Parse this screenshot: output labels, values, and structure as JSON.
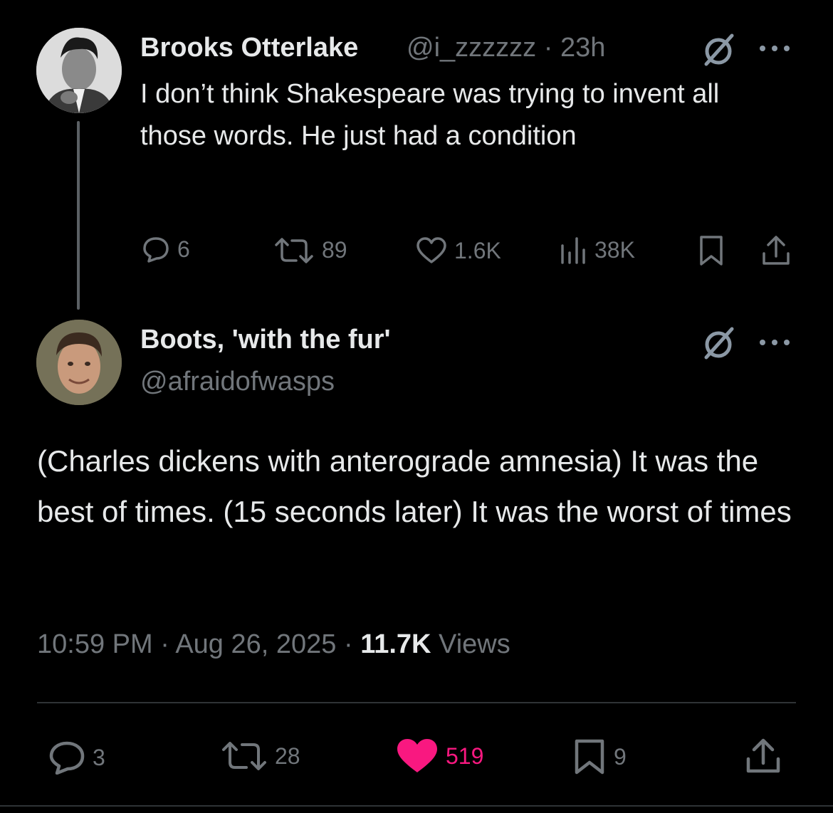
{
  "parent_tweet": {
    "display_name": "Brooks Otterlake",
    "handle": "@i_zzzzzz",
    "separator": "·",
    "time": "23h",
    "text": "I don’t think Shakespeare was trying to invent all those words. He just had a condition",
    "stats": {
      "replies": "6",
      "reposts": "89",
      "likes": "1.6K",
      "views": "38K"
    }
  },
  "main_tweet": {
    "display_name": "Boots, 'with the fur'",
    "handle": "@afraidofwasps",
    "text": "(Charles dickens with anterograde amnesia) It was the best of times. (15 seconds later) It was the worst of times",
    "timestamp": "10:59 PM · Aug 26, 2025 · ",
    "views_count": "11.7K",
    "views_label": " Views",
    "stats": {
      "replies": "3",
      "reposts": "28",
      "likes": "519",
      "bookmarks": "9"
    }
  },
  "colors": {
    "background": "#000000",
    "text_primary": "#e7e9ea",
    "text_secondary": "#71767b",
    "like_active": "#f91880",
    "divider": "#2f3336"
  },
  "icons": {
    "grok": "slashed-circle-icon",
    "more": "more-dots-icon",
    "reply": "reply-bubble-icon",
    "repost": "repost-arrows-icon",
    "like": "heart-icon",
    "views": "bar-chart-icon",
    "bookmark": "bookmark-icon",
    "share": "share-upload-icon"
  }
}
